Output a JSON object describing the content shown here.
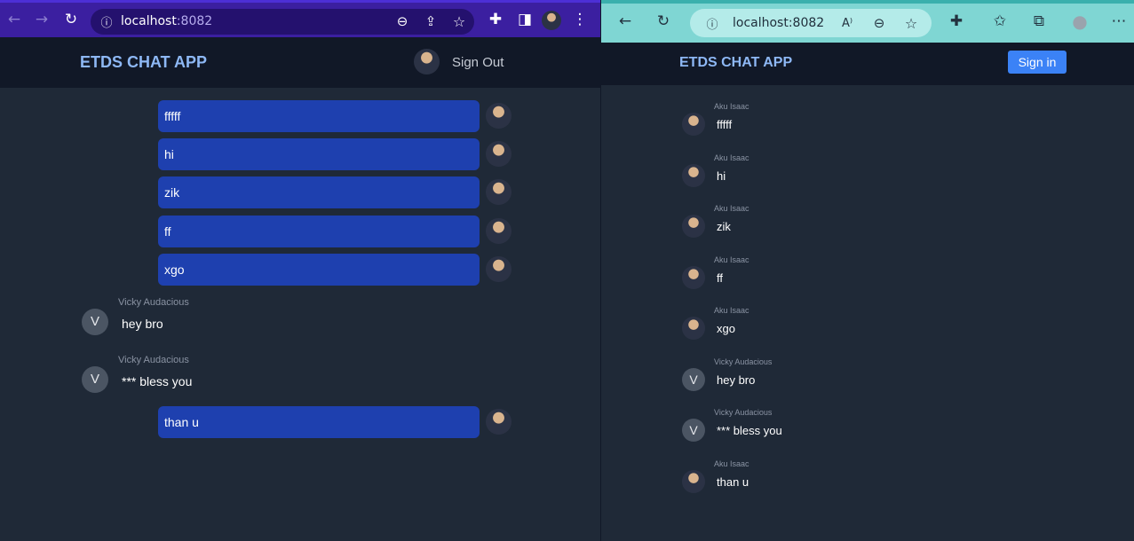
{
  "left_browser": {
    "url_host": "localhost",
    "url_port": ":8082"
  },
  "right_browser": {
    "url": "localhost:8082"
  },
  "left_app": {
    "title": "ETDS CHAT APP",
    "signout_label": "Sign Out",
    "sent_messages_top": [
      "fffff",
      "hi",
      "zik",
      "ff",
      "xgo"
    ],
    "received": [
      {
        "sender": "Vicky Audacious",
        "initial": "V",
        "text": "hey bro"
      },
      {
        "sender": "Vicky Audacious",
        "initial": "V",
        "text": "*** bless you"
      }
    ],
    "sent_last": "than u"
  },
  "right_app": {
    "title": "ETDS CHAT APP",
    "signin_label": "Sign in",
    "messages": [
      {
        "sender": "Aku Isaac",
        "text": "fffff",
        "avatar": "photo"
      },
      {
        "sender": "Aku Isaac",
        "text": "hi",
        "avatar": "photo"
      },
      {
        "sender": "Aku Isaac",
        "text": "zik",
        "avatar": "photo"
      },
      {
        "sender": "Aku Isaac",
        "text": "ff",
        "avatar": "photo"
      },
      {
        "sender": "Aku Isaac",
        "text": "xgo",
        "avatar": "photo"
      },
      {
        "sender": "Vicky Audacious",
        "text": "hey bro",
        "avatar": "V"
      },
      {
        "sender": "Vicky Audacious",
        "text": "*** bless you",
        "avatar": "V"
      },
      {
        "sender": "Aku Isaac",
        "text": "than u",
        "avatar": "photo"
      }
    ]
  },
  "colors": {
    "sent_bubble": "#1e40af",
    "app_title": "#8eb8f5",
    "signin_button": "#3b82f6",
    "chrome_toolbar": "#3b1fa0",
    "edge_toolbar": "#7fd6d3"
  },
  "icons": {
    "chrome": [
      "back-arrow-icon",
      "forward-arrow-icon",
      "reload-icon",
      "info-icon",
      "zoom-out-icon",
      "share-icon",
      "star-icon",
      "extensions-icon",
      "side-panel-icon",
      "profile-avatar",
      "more-vert-icon"
    ],
    "edge": [
      "back-arrow-icon",
      "reload-icon",
      "info-icon",
      "read-aloud-icon",
      "zoom-out-icon",
      "add-favorite-icon",
      "extensions-icon",
      "favorites-icon",
      "collections-icon",
      "profile-icon",
      "more-horiz-icon"
    ]
  }
}
